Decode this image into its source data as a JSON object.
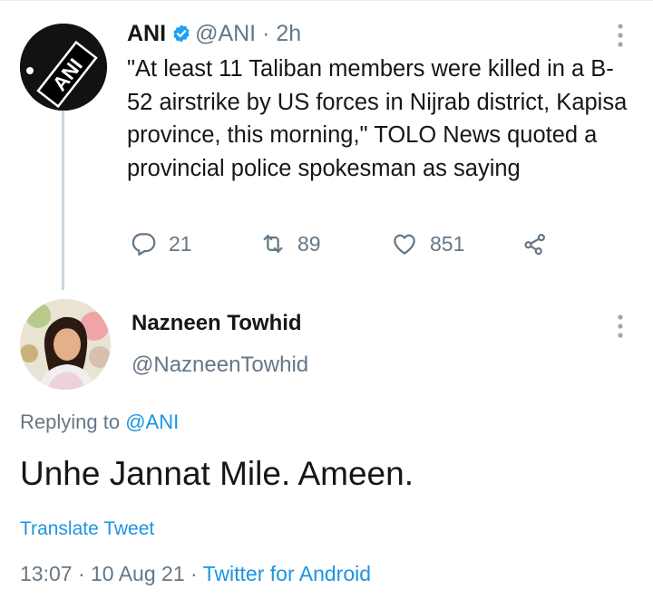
{
  "colors": {
    "link_blue": "#1b95e0",
    "muted_gray": "#657786",
    "text_dark": "#14171a",
    "thread_line": "#ccd6dd"
  },
  "original_tweet": {
    "logo_text": "ANI",
    "name": "ANI",
    "verified_icon": "verified-badge-icon",
    "handle": "@ANI",
    "separator": "·",
    "time_ago": "2h",
    "text": "\"At least 11 Taliban members were killed in a B-52 airstrike by US forces in Nijrab district, Kapisa province, this morning,\" TOLO News quoted a provincial police spokesman as saying",
    "actions": {
      "reply": {
        "icon": "reply-icon",
        "count": "21"
      },
      "retweet": {
        "icon": "retweet-icon",
        "count": "89"
      },
      "like": {
        "icon": "heart-icon",
        "count": "851"
      },
      "share": {
        "icon": "share-icon"
      }
    },
    "more_icon": "more-vertical-icon"
  },
  "reply_tweet": {
    "name": "Nazneen Towhid",
    "handle": "@NazneenTowhid",
    "more_icon": "more-vertical-icon",
    "replying_prefix": "Replying to",
    "replying_mention": "@ANI",
    "text": "Unhe Jannat Mile. Ameen.",
    "translate_label": "Translate Tweet",
    "time": "13:07",
    "date": "10 Aug 21",
    "source": "Twitter for Android"
  }
}
